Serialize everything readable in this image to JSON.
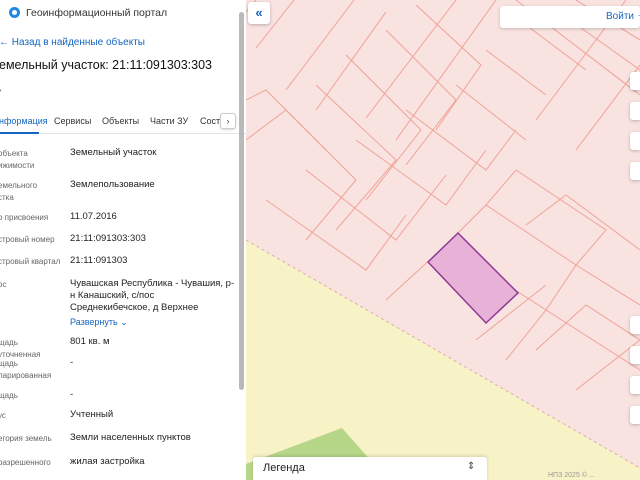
{
  "header": {
    "portal_title": "Геоинформационный портал",
    "back_link": "Назад в найденные объекты",
    "object_title": "емельный участок: 21:11:091303:303"
  },
  "tabs": [
    {
      "label": "нформация",
      "active": true
    },
    {
      "label": "Сервисы",
      "active": false
    },
    {
      "label": "Объекты",
      "active": false
    },
    {
      "label": "Части ЗУ",
      "active": false
    },
    {
      "label": "Соста",
      "active": false
    }
  ],
  "fields": [
    {
      "label": "объекта\nижимости",
      "value": "Земельный участок"
    },
    {
      "label": "емельного\nстка",
      "value": "Землепользование"
    },
    {
      "label": "о присвоения",
      "value": "11.07.2016"
    },
    {
      "label": "стровый номер",
      "value": "21:11:091303:303"
    },
    {
      "label": "стровый квартал",
      "value": "21:11:091303"
    },
    {
      "label": "ос",
      "value": "Чувашская Республика - Чувашия, р-н Канашский, с/пос Среднекибечское, д Верхнее"
    },
    {
      "label": "щадь уточненная",
      "value": "801 кв. м"
    },
    {
      "label": "щадь\nларированная",
      "value": "-"
    },
    {
      "label": "щадь",
      "value": "-"
    },
    {
      "label": "ус",
      "value": "Учтенный"
    },
    {
      "label": "егория земель",
      "value": "Земли населенных пунктов"
    },
    {
      "label": "разрешенного",
      "value": "жилая застройка"
    }
  ],
  "expand_label": "Развернуть",
  "map": {
    "login_label": "Войти",
    "legend_label": "Легенда",
    "scale_label": "НПЗ 2025 © ...",
    "colors": {
      "map_bg": "#f9e3e1",
      "parcel_line": "#f0a296",
      "selected_fill": "#e8b2d8",
      "selected_stroke": "#8e3a92",
      "yellow_zone": "#f8f2c7",
      "green_zone": "#b6d787"
    }
  },
  "icons": {
    "portal": "globe-icon",
    "collapse": "double-chevron-left-icon",
    "login_arrow": "arrow-right-icon",
    "expand": "chevron-down-icon",
    "legend_toggle": "expand-vertical-icon"
  }
}
